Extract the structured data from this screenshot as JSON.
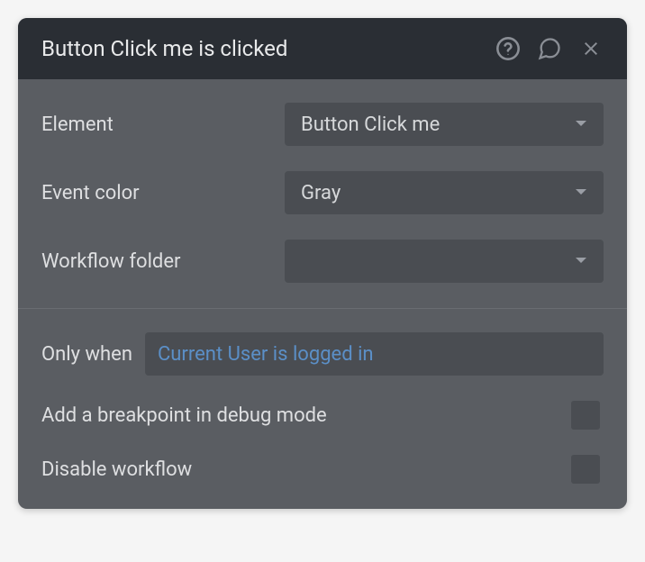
{
  "header": {
    "title": "Button Click me is clicked"
  },
  "fields": {
    "element": {
      "label": "Element",
      "value": "Button Click me"
    },
    "event_color": {
      "label": "Event color",
      "value": "Gray"
    },
    "workflow_folder": {
      "label": "Workflow folder",
      "value": ""
    }
  },
  "condition": {
    "label": "Only when",
    "value": "Current User is logged in"
  },
  "checkboxes": {
    "breakpoint": {
      "label": "Add a breakpoint in debug mode"
    },
    "disable": {
      "label": "Disable workflow"
    }
  }
}
